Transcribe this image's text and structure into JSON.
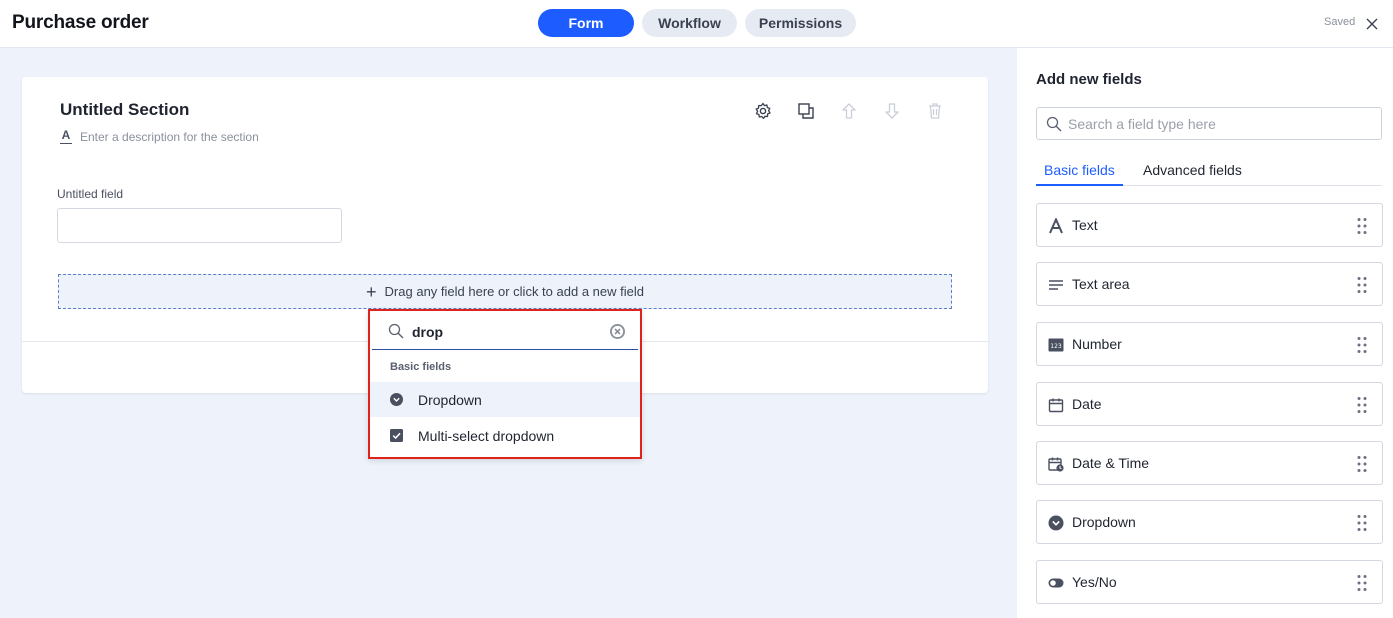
{
  "header": {
    "title": "Purchase order",
    "tabs": [
      {
        "label": "Form",
        "active": true
      },
      {
        "label": "Workflow",
        "active": false
      },
      {
        "label": "Permissions",
        "active": false
      }
    ],
    "status": "Saved"
  },
  "section": {
    "title": "Untitled Section",
    "description_placeholder": "Enter a description for the section",
    "field_label": "Untitled field",
    "drop_zone_text": "Drag any field here or click to add a new field"
  },
  "popup": {
    "search_value": "drop",
    "category": "Basic fields",
    "items": [
      {
        "label": "Dropdown",
        "icon": "chevron-circle-icon"
      },
      {
        "label": "Multi-select dropdown",
        "icon": "checkbox-icon"
      }
    ]
  },
  "panel": {
    "title": "Add new fields",
    "search_placeholder": "Search a field type here",
    "tabs": [
      {
        "label": "Basic fields",
        "active": true
      },
      {
        "label": "Advanced fields",
        "active": false
      }
    ],
    "fields": [
      {
        "label": "Text",
        "icon": "text-icon"
      },
      {
        "label": "Text area",
        "icon": "text-area-icon"
      },
      {
        "label": "Number",
        "icon": "number-icon"
      },
      {
        "label": "Date",
        "icon": "calendar-icon"
      },
      {
        "label": "Date & Time",
        "icon": "calendar-clock-icon"
      },
      {
        "label": "Dropdown",
        "icon": "chevron-circle-icon"
      },
      {
        "label": "Yes/No",
        "icon": "toggle-icon"
      }
    ]
  },
  "colors": {
    "accent": "#1d5cff",
    "highlight_border": "#e0221c",
    "canvas_bg": "#eef2fa"
  }
}
